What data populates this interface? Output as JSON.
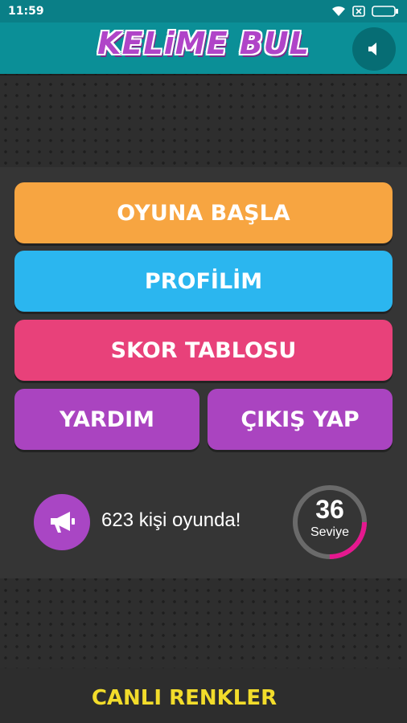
{
  "status_bar": {
    "time": "11:59"
  },
  "header": {
    "logo": "KELiME BUL",
    "sound_icon": "speaker-icon"
  },
  "menu": {
    "start": "OYUNA BAŞLA",
    "profile": "PROFİLİM",
    "scoreboard": "SKOR TABLOSU",
    "help": "YARDIM",
    "exit": "ÇIKIŞ YAP"
  },
  "info": {
    "online_text": "623 kişi oyunda!",
    "online_icon": "megaphone-icon"
  },
  "level": {
    "number": "36",
    "label": "Seviye",
    "progress": 0.25
  },
  "footer": {
    "link": "CANLI RENKLER"
  },
  "colors": {
    "header": "#0b8f97",
    "start": "#f7a541",
    "profile": "#2bb6ef",
    "scoreboard": "#e8417a",
    "help": "#aa44c0",
    "exit": "#aa44c0",
    "level_progress": "#e5188f",
    "footer_link": "#f2dc2b"
  }
}
